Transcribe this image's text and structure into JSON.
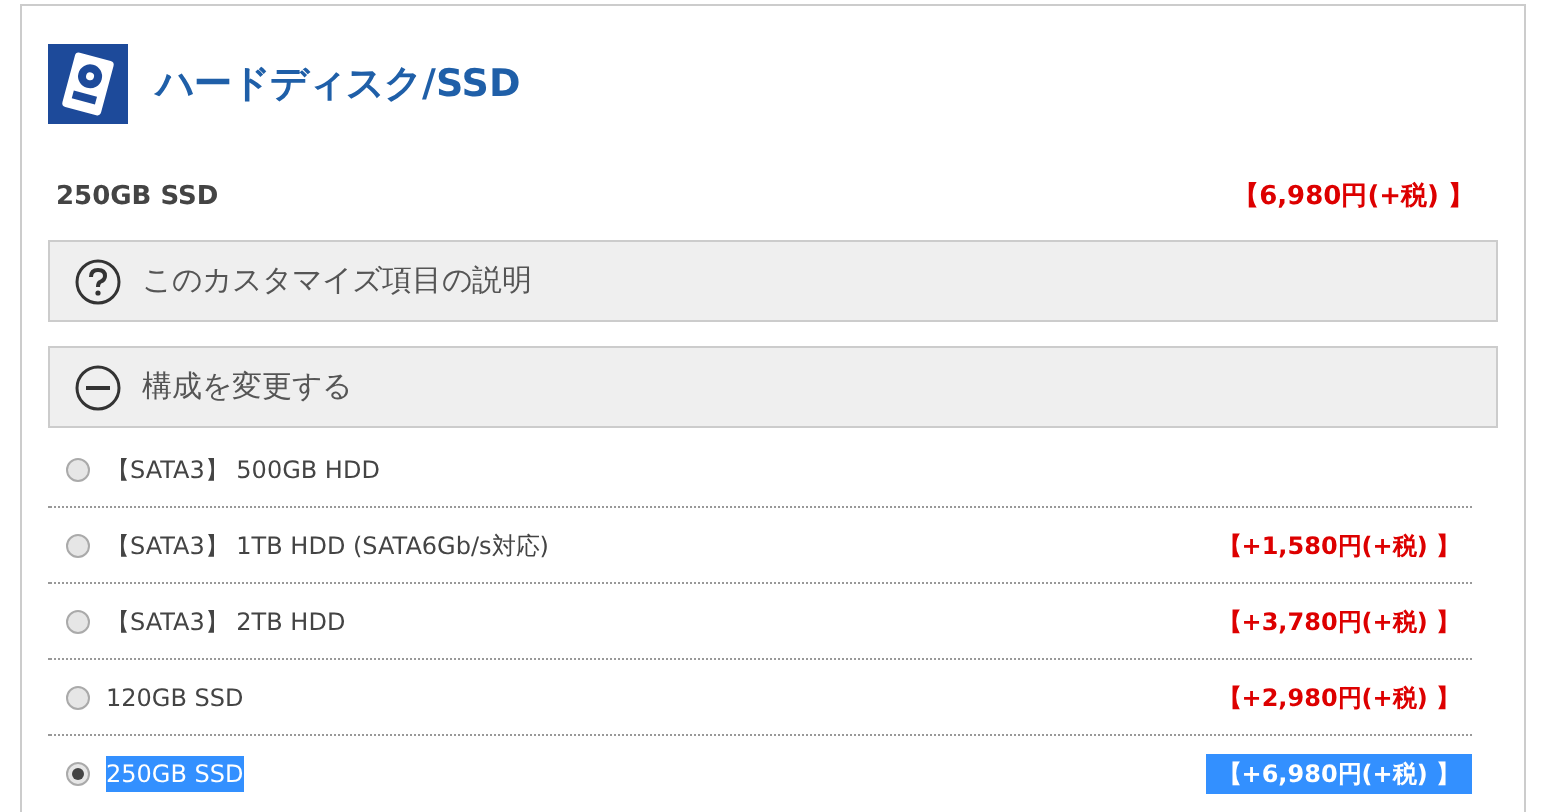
{
  "section": {
    "title": "ハードディスク/SSD"
  },
  "current": {
    "name": "250GB SSD",
    "price": "【6,980円(+税) 】"
  },
  "panels": [
    {
      "kind": "help",
      "label": "このカスタマイズ項目の説明"
    },
    {
      "kind": "collapse",
      "label": "構成を変更する"
    }
  ],
  "options": [
    {
      "label": "【SATA3】 500GB HDD",
      "selected": false
    },
    {
      "label": "【SATA3】 1TB HDD (SATA6Gb/s対応)",
      "price": "【+1,580円(+税) 】",
      "selected": false
    },
    {
      "label": "【SATA3】 2TB HDD",
      "price": "【+3,780円(+税) 】",
      "selected": false
    },
    {
      "label": "120GB SSD",
      "price": "【+2,980円(+税) 】",
      "selected": false
    },
    {
      "label": "250GB SSD",
      "price": "【+6,980円(+税) 】",
      "selected": true
    }
  ]
}
